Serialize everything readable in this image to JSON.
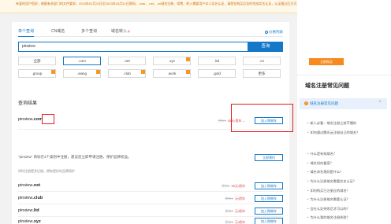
{
  "notice": "亲爱的用户您好，根据有关部门的文件要求，2023年02月20日至2023年03月31日期间，.com、.net、.cn域名注册、续费、转入需要用户本人实名认证，请您在购买后及时完成实名认证，认证通过后方可正常使用。如有疑问请联系客服。",
  "tabs": [
    {
      "label": "单个查询",
      "active": true
    },
    {
      "label": "CN域名",
      "active": false
    },
    {
      "label": "多个查询",
      "active": false
    },
    {
      "label": "域名转入",
      "active": false,
      "badge": "新"
    }
  ],
  "batch_link": "价格列表",
  "search": {
    "value": "pinsiew",
    "button": "查询"
  },
  "suffixes": [
    {
      "label": "全部",
      "selected": false,
      "tag": false
    },
    {
      "label": ".com",
      "selected": true,
      "tag": false
    },
    {
      "label": ".net",
      "selected": false,
      "tag": false
    },
    {
      "label": ".xyz",
      "selected": false,
      "tag": true
    },
    {
      "label": ".ltd",
      "selected": false,
      "tag": false
    },
    {
      "label": ".cn",
      "selected": false,
      "tag": false
    },
    {
      "label": ".group",
      "selected": false,
      "tag": true
    },
    {
      "label": ".wang",
      "selected": false,
      "tag": true
    },
    {
      "label": ".club",
      "selected": false,
      "tag": true
    },
    {
      "label": ".work",
      "selected": false,
      "tag": true
    },
    {
      "label": ".gold",
      "selected": false,
      "tag": false
    },
    {
      "label": "更多",
      "selected": false,
      "tag": false
    }
  ],
  "results_title": "查询结果",
  "main_result": {
    "name": "pinsiew",
    "suffix": ".com",
    "old_price": "原价¥",
    "price": "55元/首年",
    "button": "加入购物车"
  },
  "reminder": {
    "prefix": "\"pinsiew\" 商标在4个类别中注册，建议您立即申请注册，保护品牌权益。",
    "button": "立即预约"
  },
  "reco_title": "同时注册更多后缀，拥有更好的品牌保护",
  "results": [
    {
      "name": "pinsiew",
      "suffix": ".net",
      "old_price": "原价¥",
      "price": "55元/首年",
      "button": "加入购物车"
    },
    {
      "name": "pinsiew",
      "suffix": ".club",
      "old_price": "原价¥",
      "price": "元/首年",
      "button": "加入购物车"
    },
    {
      "name": "pinsiew",
      "suffix": ".ltd",
      "old_price": "原价¥",
      "price": "元/首年",
      "button": "加入购物车"
    },
    {
      "name": "pinsiew",
      "suffix": ".xyz",
      "old_price": "原价¥",
      "price": "元/首年",
      "button": "加入购物车"
    }
  ],
  "right": {
    "order_button": "立即购买",
    "faq_title": "域名注册常见问题",
    "faq_sub": "域名注册常见问题",
    "questions": [
      "新人必看：域名注册之前不懂的",
      "如何通过腾讯云注册自己的域名？",
      "什么是有效域名？",
      "域名如何备案？",
      "域名命名规则是什么？",
      "为什么注册域名需要实名认证？",
      "如何购买已注册过的域名？",
      "为什么注册域名需要认证？",
      "会在认证失败后才可以的？",
      "为什么我的域名注册失败？"
    ]
  },
  "colors": {
    "accent": "#1478c8",
    "highlight": "#e02020",
    "orange": "#f78a1f"
  }
}
